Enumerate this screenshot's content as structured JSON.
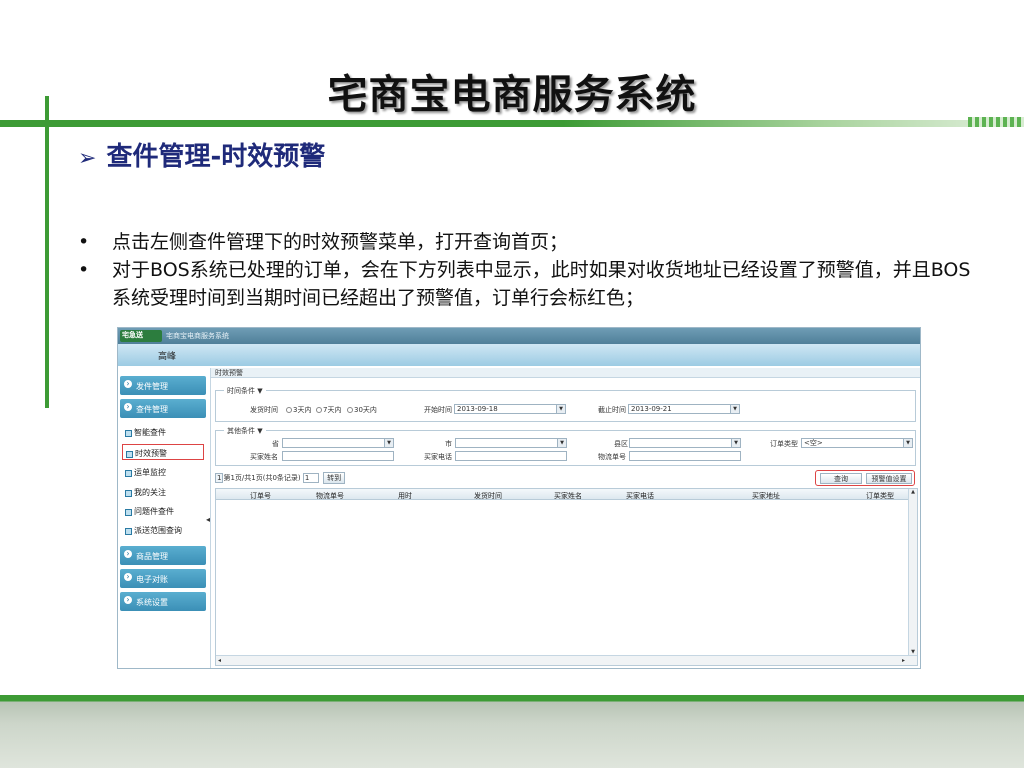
{
  "slide": {
    "title": "宅商宝电商服务系统",
    "subheading": "查件管理-时效预警",
    "arrow": "➢",
    "bullets": [
      "点击左侧查件管理下的时效预警菜单，打开查询首页；",
      "对于BOS系统已处理的订单，会在下方列表中显示，此时如果对收货地址已经设置了预警值，并且BOS系统受理时间到当期时间已经超出了预警值，订单行会标红色；"
    ]
  },
  "app": {
    "logo": "宅急送",
    "title": "宅商宝电商服务系统",
    "user": "高峰",
    "sidebar": {
      "menus_top": [
        "发件管理",
        "查件管理"
      ],
      "sub_items": [
        "智能查件",
        "时效预警",
        "运单监控",
        "我的关注",
        "问题件查件",
        "派送范围查询"
      ],
      "menus_bottom": [
        "商品管理",
        "电子对账",
        "系统设置"
      ]
    },
    "panel": {
      "title": "时效预警",
      "time_group": {
        "legend": "时间条件 ▼",
        "ship_time_label": "发货时间",
        "radios": [
          "3天内",
          "7天内",
          "30天内"
        ],
        "start_label": "开始时间",
        "start_value": "2013-09-18",
        "end_label": "截止时间",
        "end_value": "2013-09-21"
      },
      "other_group": {
        "legend": "其他条件 ▼",
        "province_label": "省",
        "city_label": "市",
        "county_label": "县区",
        "order_type_label": "订单类型",
        "order_type_value": "<空>",
        "buyer_name_label": "买家姓名",
        "buyer_phone_label": "买家电话",
        "tracking_label": "物流单号"
      },
      "pager": {
        "page_num": "1",
        "text": "第1页/共1页(共0条记录)",
        "goto_value": "1",
        "goto_label": "转到"
      },
      "buttons": {
        "query": "查询",
        "threshold": "预警值设置"
      },
      "columns": [
        "订单号",
        "物流单号",
        "用时",
        "发货时间",
        "买家姓名",
        "买家电话",
        "买家地址",
        "订单类型"
      ]
    }
  }
}
